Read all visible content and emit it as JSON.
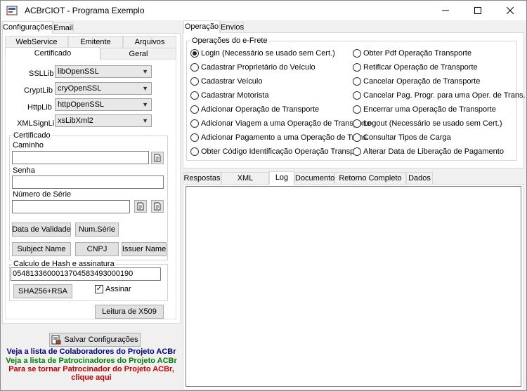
{
  "window": {
    "title": "ACBrCIOT - Programa Exemplo",
    "app_icon": "acbr-app-icon",
    "controls": [
      "minimize-icon",
      "maximize-icon",
      "close-icon"
    ]
  },
  "left": {
    "top_tabs": [
      "Configurações",
      "Email"
    ],
    "sub_tabs_row1": [
      "WebService",
      "Emitente",
      "Arquivos"
    ],
    "sub_tabs_row2": [
      "Certificado",
      "Geral"
    ],
    "libs": {
      "ssl_label": "SSLLib",
      "ssl_value": "libOpenSSL",
      "crypt_label": "CryptLib",
      "crypt_value": "cryOpenSSL",
      "http_label": "HttpLib",
      "http_value": "httpOpenSSL",
      "xmlsign_label": "XMLSignLib",
      "xmlsign_value": "xsLibXml2"
    },
    "certificado": {
      "group_title": "Certificado",
      "caminho_label": "Caminho",
      "caminho_value": "",
      "senha_label": "Senha",
      "senha_value": "",
      "serie_label": "Número de Série",
      "serie_value": "",
      "btn_validade": "Data de Validade",
      "btn_numserie": "Num.Série",
      "btn_subject": "Subject Name",
      "btn_cnpj": "CNPJ",
      "btn_issuer": "Issuer Name"
    },
    "hash": {
      "group_title": "Calculo de Hash e assinatura",
      "value": "05481336000137045834930001​90",
      "btn_sha": "SHA256+RSA",
      "assinar_label": "Assinar",
      "assinar_checked": true
    },
    "btn_leitura": "Leitura de X509",
    "btn_salvar": "Salvar Configurações",
    "links": {
      "colaboradores": "Veja a lista de Colaboradores do Projeto ACBr",
      "patrocinadores": "Veja a lista de Patrocinadores do Projeto ACBr",
      "tornar_line1": "Para se tornar Patrocinador do Projeto ACBr,",
      "tornar_line2": "clique aqui"
    },
    "colors": {
      "link_blue": "#000080",
      "link_green": "#008000",
      "link_red": "#cc0000"
    }
  },
  "right": {
    "top_tabs": [
      "Operação",
      "Envios"
    ],
    "ops_group_title": "Operações do e-Frete",
    "ops_col1": [
      "Login (Necessário se usado sem Cert.)",
      "Cadastrar Proprietário do Veículo",
      "Cadastrar Veículo",
      "Cadastrar Motorista",
      "Adicionar Operação de Transporte",
      "Adicionar Viagem a uma Operação de Transporte",
      "Adicionar Pagamento a uma Operação de Trans.",
      "Obter Código Identificação Operação Transp."
    ],
    "ops_col2": [
      "Obter Pdf Operação Transporte",
      "Retificar Operação de Transporte",
      "Cancelar Operação de Transporte",
      "Cancelar Pag. Progr. para uma Oper. de Trans.",
      "Encerrar uma Operação de Transporte",
      "Logout (Necessário se usado sem Cert.)",
      "Consultar Tipos de Carga",
      "Alterar Data de Liberação de Pagamento"
    ],
    "selected_op": "Login (Necessário se usado sem Cert.)",
    "bottom_tabs": [
      "Respostas",
      "XML Resposta",
      "Log",
      "Documento",
      "Retorno Completo WS",
      "Dados"
    ],
    "active_bottom_tab": "Log"
  }
}
